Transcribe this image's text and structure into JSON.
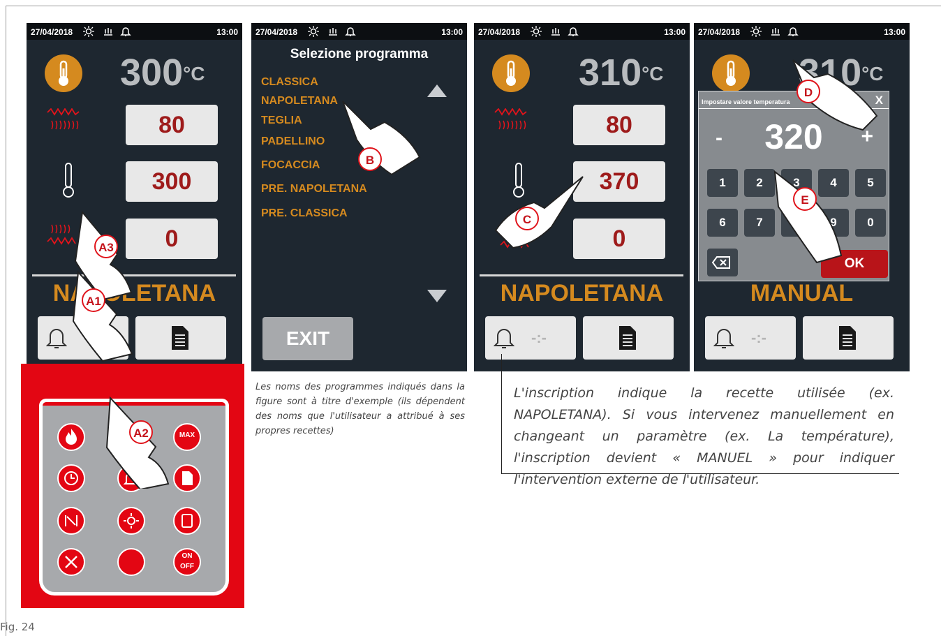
{
  "status_bar": {
    "date": "27/04/2018",
    "time": "13:00"
  },
  "screen1": {
    "temp": "300",
    "unit": "°C",
    "val_top": "80",
    "val_mid": "300",
    "val_bot": "0",
    "program": "NAPOLETANA"
  },
  "screen2": {
    "title": "Selezione programma",
    "programs": [
      "CLASSICA",
      "NAPOLETANA",
      "TEGLIA",
      "PADELLINO",
      "FOCACCIA",
      "PRE. NAPOLETANA",
      "PRE. CLASSICA"
    ],
    "exit_label": "EXIT"
  },
  "screen3": {
    "temp": "310",
    "unit": "°C",
    "val_top": "80",
    "val_mid": "370",
    "val_bot": "0",
    "program": "NAPOLETANA"
  },
  "screen4": {
    "temp": "310",
    "unit": "°C",
    "program": "MANUAL",
    "dialog_title": "Impostare valore temperatura",
    "close": "X",
    "minus": "-",
    "plus": "+",
    "value": "320",
    "keys": [
      "1",
      "2",
      "3",
      "4",
      "5",
      "6",
      "7",
      "8",
      "9",
      "0"
    ],
    "ok": "OK"
  },
  "markers": {
    "a1": "A1",
    "a2": "A2",
    "a3": "A3",
    "b": "B",
    "c": "C",
    "d": "D",
    "e": "E"
  },
  "panel_buttons": {
    "max": "MAX",
    "on": "ON",
    "off": "OFF"
  },
  "dash": "-:-",
  "captions": {
    "programs_note": "Les noms des programmes indiqués dans la figure sont à titre d'exemple (ils dépendent des noms que l'utilisateur a attribué à ses propres recettes)",
    "inscription_note": "L'inscription indique la recette utilisée (ex. NAPOLETANA). Si vous intervenez manuellement en changeant un paramètre (ex. La température), l'inscription devient « MANUEL » pour indiquer l'intervention externe de l'utilisateur."
  },
  "figure_label": "Fig. 24",
  "colors": {
    "screen_bg": "#1e2730",
    "accent_orange": "#d58a1f",
    "value_red": "#9e1b1b",
    "panel_red": "#e30613",
    "ok_red": "#b81419"
  }
}
